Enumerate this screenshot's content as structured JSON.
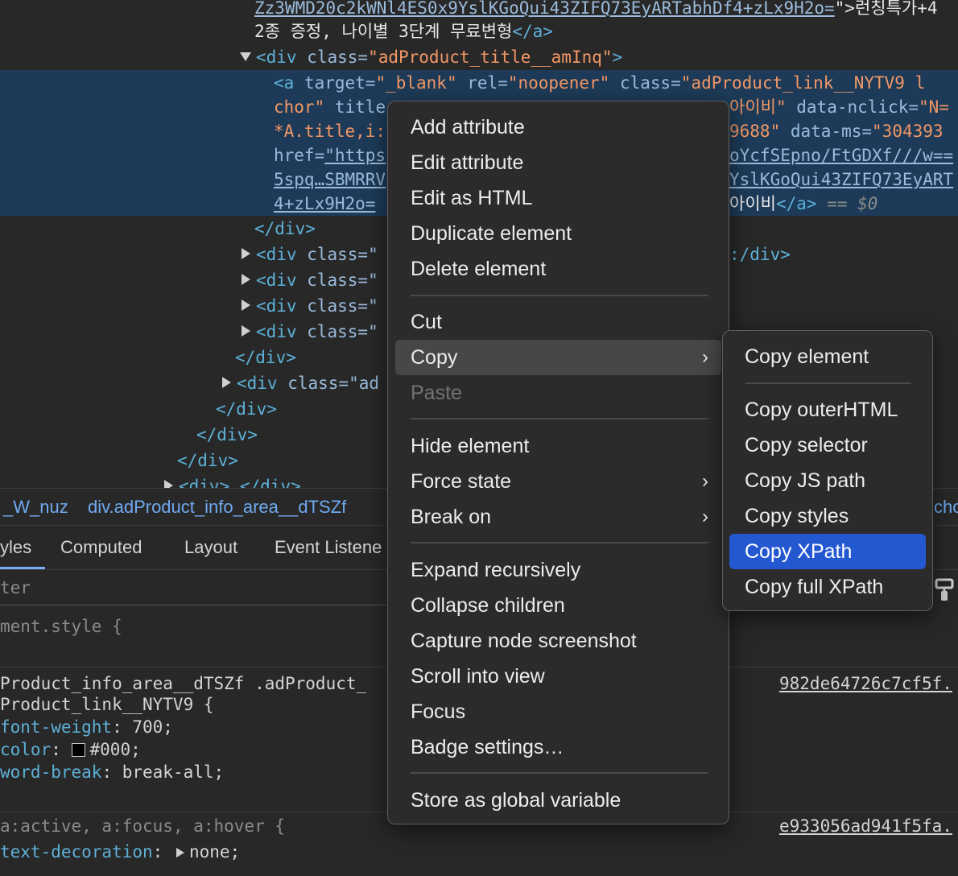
{
  "tree": {
    "l1_link": "Zz3WMD20c2kWNl4ES0x9YslKGoQui43ZIFQ73EyARTabhDf4+zLx9H2o=",
    "l1_tail": "\">런칭특가+4",
    "l2_text": "2종 증정, 나이별 3단계 무료변형",
    "l2_close": "</a>",
    "l3_open": "<div ",
    "l3_attr": "class=",
    "l3_val": "\"adProduct_title__amInq\"",
    "l3_close": ">",
    "a_line1_tag": "<a ",
    "a_line1_a1": "target=",
    "a_line1_v1": "\"_blank\"",
    "a_line1_a2": "rel=",
    "a_line1_v2": "\"noopener\"",
    "a_line1_a3": "class=",
    "a_line1_v3": "\"adProduct_link__NYTV9 l",
    "a_line2_val": "chor\"",
    "a_line2_attr": "title",
    "a_line2_right_val": "아이비\"",
    "a_line2_right_attr": "data-nclick=",
    "a_line2_right_v": "\"N=",
    "a_line3_val": "*A.title,i:",
    "a_line3_right_val": "9688\"",
    "a_line3_right_attr": "data-ms=",
    "a_line3_right_v": "\"304393",
    "a_line4_attr": "href=",
    "a_line4_link": "\"https",
    "a_line4_right": "oYcfSEpno/FtGDXf///w==",
    "a_line5_link": "5spq…SBMRRV",
    "a_line5_right": "YslKGoQui43ZIFQ73EyART",
    "a_line6_link": "4+zLx9H2o=",
    "a_line6_right_text": "아이비",
    "a_line6_right_close": "</a>",
    "a_line6_eq": "== $0",
    "close_div": "</div>",
    "div_open": "<div ",
    "div_class": "class=\"",
    "div_class_ad": "class=\"ad",
    "right_close_div": ":/div>",
    "ellipsis_line": "<div>",
    "ellipsis_badge": "…",
    "ellipsis_tail": "</div>"
  },
  "breadcrumb": {
    "item1": "_W_nuz",
    "item2": "div.adProduct_info_area__dTSZf",
    "item3": "cho"
  },
  "tabs": {
    "styles": "yles",
    "computed": "Computed",
    "layout": "Layout",
    "event_listeners": "Event Listene"
  },
  "filter_placeholder": "ter",
  "styles": {
    "element_style": "ment.style {",
    "rule1_sel1": "Product_info_area__dTSZf .adProduct_",
    "rule1_sel2": "Product_link__NYTV9 {",
    "rule1_source": "982de64726c7cf5f.",
    "p1_name": "font-weight",
    "p1_val": "700;",
    "p2_name": "color",
    "p2_val": "#000;",
    "p3_name": "word-break",
    "p3_val": "break-all;",
    "rule2_sel": "a:active, a:focus, a:hover {",
    "rule2_source": "e933056ad941f5fa.",
    "p4_name": "text-decoration",
    "p4_val": "none;"
  },
  "context_menu": {
    "add_attribute": "Add attribute",
    "edit_attribute": "Edit attribute",
    "edit_as_html": "Edit as HTML",
    "duplicate_element": "Duplicate element",
    "delete_element": "Delete element",
    "cut": "Cut",
    "copy": "Copy",
    "paste": "Paste",
    "hide_element": "Hide element",
    "force_state": "Force state",
    "break_on": "Break on",
    "expand_recursively": "Expand recursively",
    "collapse_children": "Collapse children",
    "capture_node_screenshot": "Capture node screenshot",
    "scroll_into_view": "Scroll into view",
    "focus": "Focus",
    "badge_settings": "Badge settings…",
    "store_as_global_variable": "Store as global variable"
  },
  "copy_submenu": {
    "copy_element": "Copy element",
    "copy_outerhtml": "Copy outerHTML",
    "copy_selector": "Copy selector",
    "copy_js_path": "Copy JS path",
    "copy_styles": "Copy styles",
    "copy_xpath": "Copy XPath",
    "copy_full_xpath": "Copy full XPath"
  },
  "colors": {
    "background": "#282828",
    "selection": "#1d3b58",
    "menu_bg": "#2b2b2b",
    "active_item": "#2458d0",
    "tag": "#5db0d7",
    "attr_value": "#f29766"
  }
}
